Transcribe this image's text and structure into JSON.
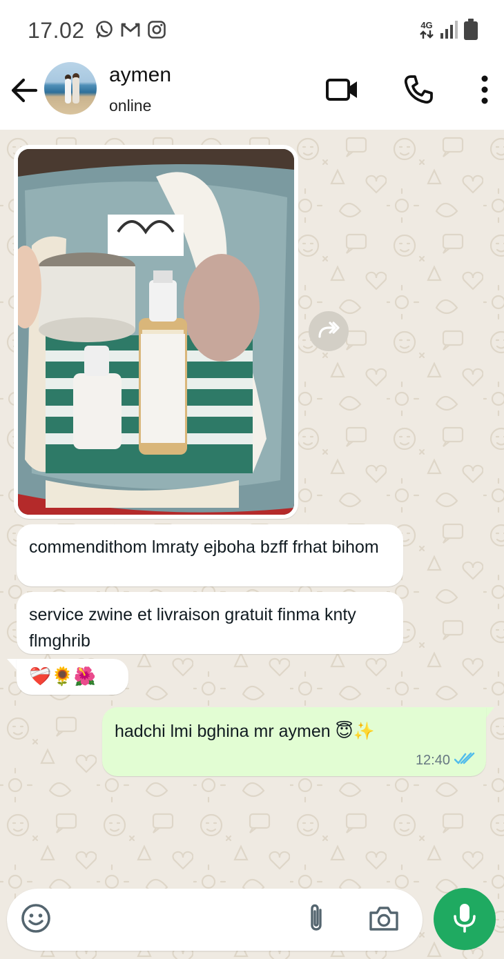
{
  "status_bar": {
    "time": "17.02",
    "network": "4G",
    "left_icons": [
      "whatsapp-icon",
      "gmail-icon",
      "instagram-icon"
    ],
    "right_icons": [
      "network-arrows-icon",
      "signal-icon",
      "battery-icon"
    ]
  },
  "header": {
    "contact_name": "aymen",
    "contact_status": "online",
    "icons": [
      "back-arrow-icon",
      "video-call-icon",
      "voice-call-icon",
      "more-options-icon"
    ]
  },
  "messages": [
    {
      "direction": "in",
      "type": "image",
      "caption": ""
    },
    {
      "direction": "in",
      "type": "text",
      "text": "commendithom lmraty ejboha bzff frhat bihom"
    },
    {
      "direction": "in",
      "type": "text",
      "text": "service zwine et livraison gratuit finma knty flmghrib"
    },
    {
      "direction": "in",
      "type": "text",
      "text": "❤️‍🩹🌻🌺"
    },
    {
      "direction": "out",
      "type": "text",
      "text": "hadchi lmi bghina mr aymen 😇✨",
      "time": "12:40",
      "status": "read"
    }
  ],
  "input": {
    "placeholder": "",
    "icons": [
      "emoji-icon",
      "attach-icon",
      "camera-icon",
      "mic-icon"
    ]
  },
  "colors": {
    "chat_background": "#efeae2",
    "incoming_bubble": "#ffffff",
    "outgoing_bubble": "#e2fdd3",
    "accent_green": "#1faa61",
    "read_tick": "#53bdeb"
  }
}
